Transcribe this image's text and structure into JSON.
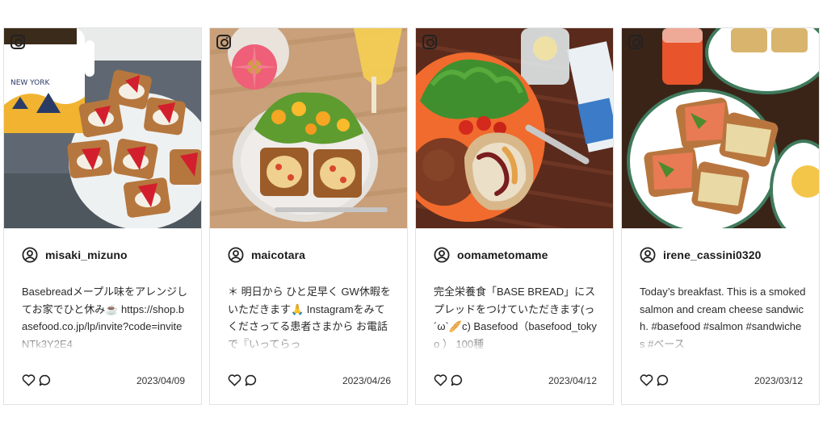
{
  "posts": [
    {
      "username": "misaki_mizuno",
      "caption": "Basebreadメープル味をアレンジしてお家でひと休み☕️ https://shop.basefood.co.jp/lp/invite?code=inviteNTk3Y2E4",
      "date": "2023/04/09",
      "photo_subject": "strawberry cream toast bites with New York mug"
    },
    {
      "username": "maicotara",
      "caption": "＊ 明日から ひと足早く GW休暇をいただきます🙏 Instagramをみてくださってる患者さまから お電話で『いってらっ",
      "date": "2023/04/26",
      "photo_subject": "egg toast with mango salad and pink gerbera"
    },
    {
      "username": "oomametomame",
      "caption": "完全栄養食「BASE BREAD」にスプレッドをつけていただきます(っ´ω`🥖c) Basefood（basefood_tokyo ） 100種",
      "date": "2023/04/12",
      "photo_subject": "brown bread roll, salad and spread on orange plate"
    },
    {
      "username": "irene_cassini0320",
      "caption": "Today’s breakfast. This is a smoked salmon and cream cheese sandwich. #basefood #salmon #sandwiches #ベース",
      "date": "2023/03/12",
      "photo_subject": "smoked salmon open sandwiches with juice"
    }
  ],
  "icons": {
    "source": "instagram-icon",
    "user": "user-circle-icon",
    "like": "heart-icon",
    "comment": "comment-icon"
  },
  "colors": {
    "card_border": "#e2e2e2",
    "text": "#222222"
  }
}
